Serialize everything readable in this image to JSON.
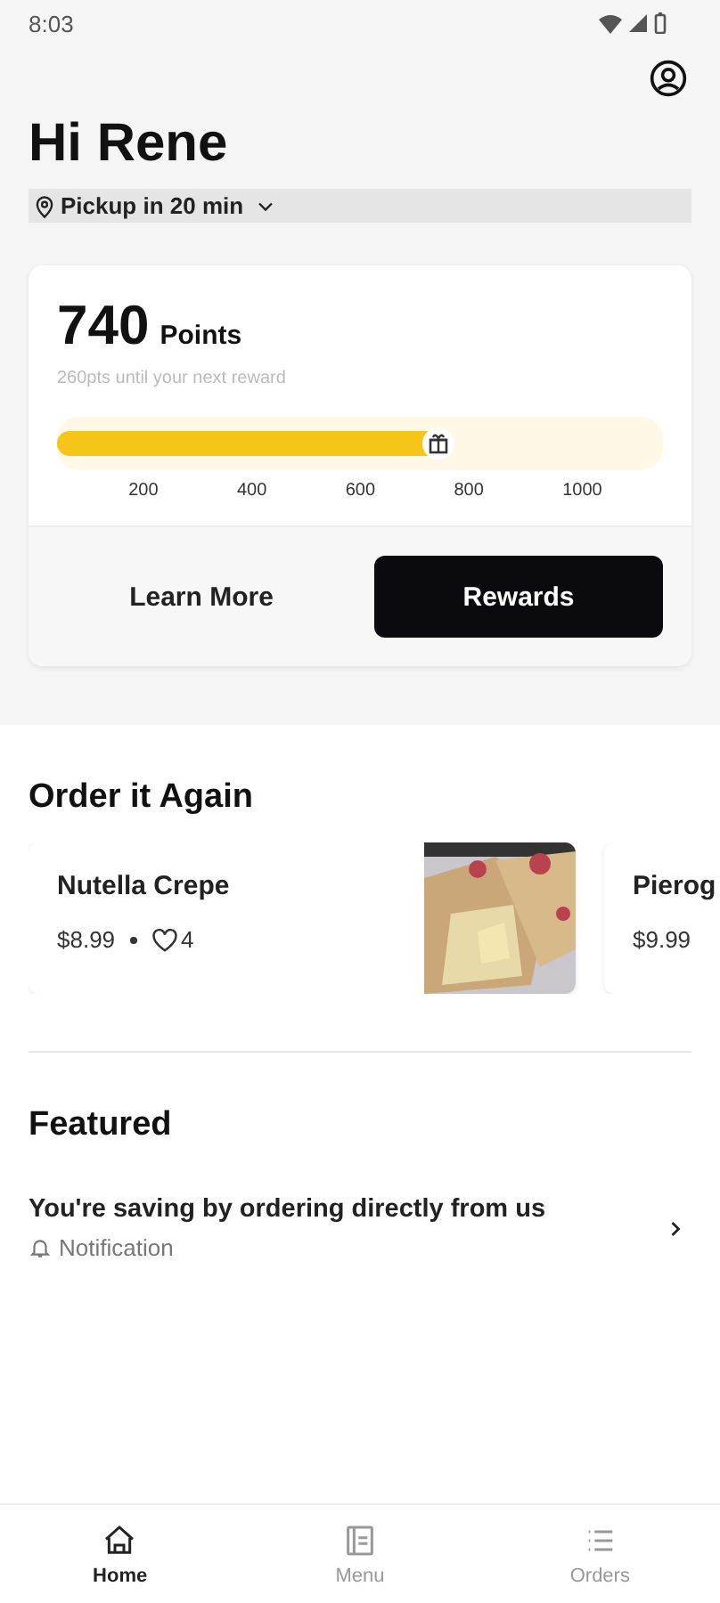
{
  "status_bar": {
    "time": "8:03"
  },
  "greeting": "Hi Rene",
  "pickup": {
    "label": "Pickup in 20 min"
  },
  "rewards": {
    "points": "740",
    "points_label": "Points",
    "subtitle": "260pts until your next reward",
    "level": 0.63,
    "ticks": [
      "200",
      "400",
      "600",
      "800",
      "1000"
    ],
    "buttons": [
      {
        "label": "Learn More",
        "kind": "plain"
      },
      {
        "label": "Rewards",
        "kind": "primary"
      }
    ]
  },
  "order_again": {
    "title": "Order it Again",
    "items": [
      {
        "name": "Nutella Crepe",
        "price": "$8.99",
        "likes": "4",
        "kind": "picture"
      },
      {
        "name": "Pierog",
        "price": "$9.99"
      }
    ]
  },
  "featured": {
    "title": "Featured",
    "items": [
      {
        "title": "You're saving by ordering directly from us",
        "tag": "Notification"
      }
    ]
  },
  "tabs": [
    {
      "label": "Home",
      "kind": "home",
      "selected": true
    },
    {
      "label": "Menu",
      "kind": "menu",
      "selected": false
    },
    {
      "label": "Orders",
      "kind": "orders",
      "selected": false
    }
  ]
}
